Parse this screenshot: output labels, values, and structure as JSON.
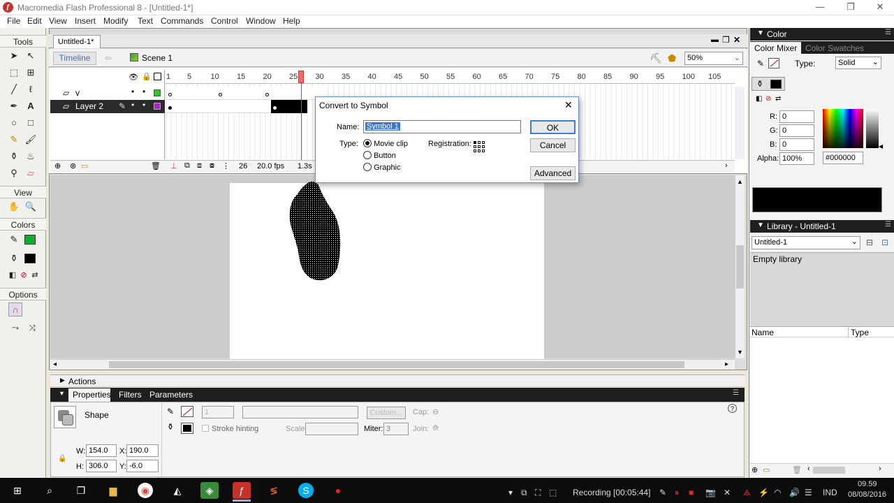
{
  "window": {
    "title": "Macromedia Flash Professional 8 - [Untitled-1*]",
    "app_icon": "flash-f-icon",
    "minimize": "—",
    "maximize": "❐",
    "close": "✕"
  },
  "menu": [
    "File",
    "Edit",
    "View",
    "Insert",
    "Modify",
    "Text",
    "Commands",
    "Control",
    "Window",
    "Help"
  ],
  "tools": {
    "header": "Tools",
    "view_header": "View",
    "colors_header": "Colors",
    "options_header": "Options"
  },
  "document": {
    "tab": "Untitled-1*",
    "timeline_button": "Timeline",
    "scene": "Scene 1",
    "zoom": "50%"
  },
  "timeline": {
    "ruler": [
      "1",
      "5",
      "10",
      "15",
      "20",
      "25",
      "30",
      "35",
      "40",
      "45",
      "50",
      "55",
      "60",
      "65",
      "70",
      "75",
      "80",
      "85",
      "90",
      "95",
      "100",
      "105"
    ],
    "layers": [
      {
        "name": "v",
        "color": "#22cc22"
      },
      {
        "name": "Layer 2",
        "color": "#aa22cc"
      }
    ],
    "current_frame": "26",
    "fps": "20.0 fps",
    "elapsed": "1.3s"
  },
  "dialog": {
    "title": "Convert to Symbol",
    "name_label": "Name:",
    "name_value": "Symbol 1",
    "type_label": "Type:",
    "types": [
      "Movie clip",
      "Button",
      "Graphic"
    ],
    "selected_type": "Movie clip",
    "registration_label": "Registration:",
    "ok": "OK",
    "cancel": "Cancel",
    "advanced": "Advanced",
    "close": "✕"
  },
  "actions_panel": {
    "label": "Actions"
  },
  "properties": {
    "tabs": [
      "Properties",
      "Filters",
      "Parameters"
    ],
    "object_type": "Shape",
    "stroke_size": "1",
    "custom_button": "Custom...",
    "cap_label": "Cap:",
    "stroke_hinting": "Stroke hinting",
    "scale_label": "Scale:",
    "miter_label": "Miter:",
    "miter_value": "3",
    "join_label": "Join:",
    "w_label": "W:",
    "w": "154.0",
    "h_label": "H:",
    "h": "306.0",
    "x_label": "X:",
    "x": "190.0",
    "y_label": "Y:",
    "y": "-6.0",
    "help": "?"
  },
  "color_panel": {
    "header": "Color",
    "tabs": [
      "Color Mixer",
      "Color Swatches"
    ],
    "type_label": "Type:",
    "type_value": "Solid",
    "r_label": "R:",
    "r": "0",
    "g_label": "G:",
    "g": "0",
    "b_label": "B:",
    "b": "0",
    "alpha_label": "Alpha:",
    "alpha": "100%",
    "hex": "#000000",
    "fill_color": "#000000"
  },
  "library_panel": {
    "header": "Library - Untitled-1",
    "document": "Untitled-1",
    "status": "Empty library",
    "col_name": "Name",
    "col_type": "Type"
  },
  "taskbar": {
    "recording": "Recording [00:05:44]",
    "language": "IND",
    "time": "09.59",
    "date": "08/08/2016"
  }
}
